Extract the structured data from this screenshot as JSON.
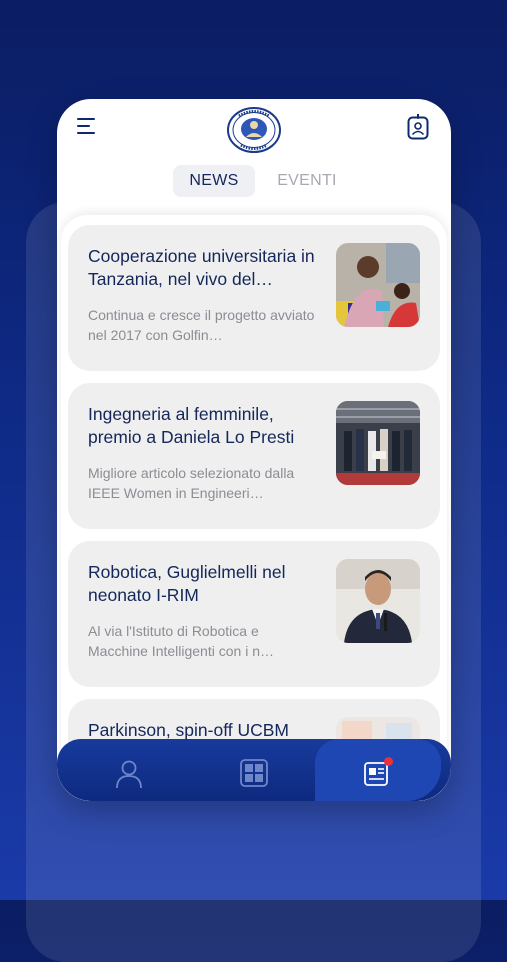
{
  "header": {
    "menu_icon": "hamburger-menu-icon",
    "logo_icon": "university-seal-logo",
    "badge_icon": "id-badge-icon"
  },
  "tabs": [
    {
      "label": "NEWS",
      "active": true
    },
    {
      "label": "EVENTI",
      "active": false
    }
  ],
  "news": [
    {
      "title": "Cooperazione universitaria in Tanzania, nel vivo del…",
      "description": "Continua e cresce il progetto avviato nel 2017 con Golfin…"
    },
    {
      "title": "Ingegneria al femminile, premio a Daniela Lo Presti",
      "description": "Migliore articolo selezionato dalla IEEE Women in Engineeri…"
    },
    {
      "title": "Robotica, Guglielmelli nel neonato I-RIM",
      "description": "Al via l'Istituto di Robotica e Macchine Intelligenti con i n…"
    },
    {
      "title": "Parkinson, spin-off UCBM",
      "description": ""
    }
  ],
  "bottom_nav": [
    {
      "icon": "user-profile-icon",
      "active": false
    },
    {
      "icon": "grid-dashboard-icon",
      "active": false
    },
    {
      "icon": "news-icon",
      "active": true,
      "notification": true
    }
  ],
  "colors": {
    "primary": "#0e2a86",
    "title_text": "#14275a",
    "notification": "#e8313b"
  }
}
